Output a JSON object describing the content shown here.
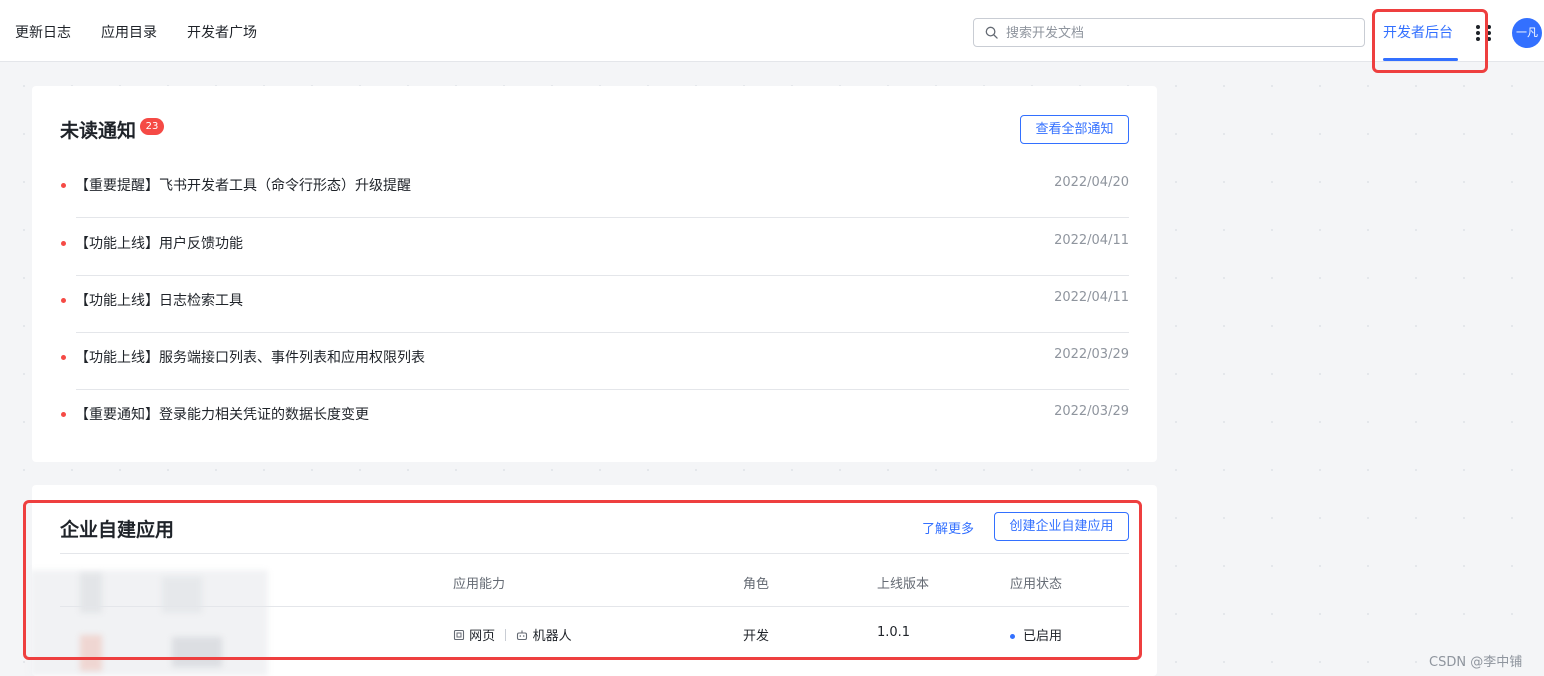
{
  "nav": {
    "links": [
      "更新日志",
      "应用目录",
      "开发者广场"
    ],
    "search_placeholder": "搜索开发文档",
    "console_tab": "开发者后台",
    "avatar_text": "一凡"
  },
  "notifications": {
    "title": "未读通知",
    "badge_count": "23",
    "view_all": "查看全部通知",
    "items": [
      {
        "text": "【重要提醒】飞书开发者工具（命令行形态）升级提醒",
        "date": "2022/04/20"
      },
      {
        "text": "【功能上线】用户反馈功能",
        "date": "2022/04/11"
      },
      {
        "text": "【功能上线】日志检索工具",
        "date": "2022/04/11"
      },
      {
        "text": "【功能上线】服务端接口列表、事件列表和应用权限列表",
        "date": "2022/03/29"
      },
      {
        "text": "【重要通知】登录能力相关凭证的数据长度变更",
        "date": "2022/03/29"
      }
    ]
  },
  "apps": {
    "title": "企业自建应用",
    "learn_more": "了解更多",
    "create_button": "创建企业自建应用",
    "columns": {
      "capability": "应用能力",
      "role": "角色",
      "version": "上线版本",
      "status": "应用状态"
    },
    "row": {
      "capability_web": "网页",
      "capability_bot": "机器人",
      "role": "开发",
      "version": "1.0.1",
      "status": "已启用"
    }
  },
  "watermark": "CSDN @李中铺",
  "colors": {
    "accent": "#3370ff",
    "badge": "#f54a45",
    "highlight": "#ee3f3f"
  }
}
